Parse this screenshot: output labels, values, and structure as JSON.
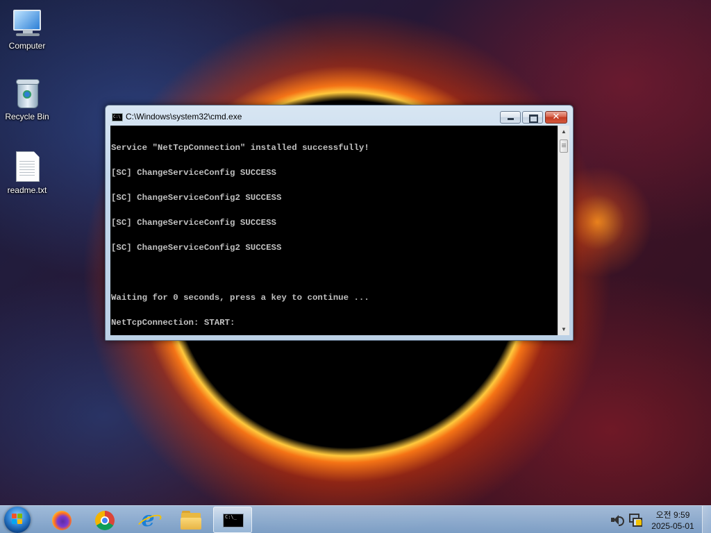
{
  "desktop": {
    "icons": [
      {
        "label": "Computer",
        "icon": "computer-icon"
      },
      {
        "label": "Recycle Bin",
        "icon": "recycle-bin-icon"
      },
      {
        "label": "readme.txt",
        "icon": "text-file-icon"
      }
    ]
  },
  "window": {
    "title": "C:\\Windows\\system32\\cmd.exe",
    "icon": "cmd-icon",
    "buttons": {
      "minimize": "minimize-icon",
      "maximize": "maximize-icon",
      "close": "close-icon"
    },
    "console_lines": [
      "Service \"NetTcpConnection\" installed successfully!",
      "[SC] ChangeServiceConfig SUCCESS",
      "[SC] ChangeServiceConfig2 SUCCESS",
      "[SC] ChangeServiceConfig SUCCESS",
      "[SC] ChangeServiceConfig2 SUCCESS",
      "",
      "Waiting for 0 seconds, press a key to continue ...",
      "NetTcpConnection: START:"
    ],
    "colors": {
      "console_bg": "#000000",
      "console_fg": "#c0c0c0"
    }
  },
  "taskbar": {
    "start": "windows-start-icon",
    "pinned": [
      {
        "name": "firefox",
        "icon": "firefox-icon"
      },
      {
        "name": "chrome",
        "icon": "chrome-icon"
      },
      {
        "name": "internet-explorer",
        "icon": "internet-explorer-icon"
      },
      {
        "name": "file-explorer",
        "icon": "folder-icon"
      },
      {
        "name": "cmd",
        "icon": "cmd-icon",
        "active": true,
        "glyph": "C:\\_"
      }
    ],
    "tray": {
      "volume": "speaker-icon",
      "network": "network-warning-icon"
    },
    "clock": {
      "time": "오전 9:59",
      "date": "2025-05-01"
    }
  }
}
